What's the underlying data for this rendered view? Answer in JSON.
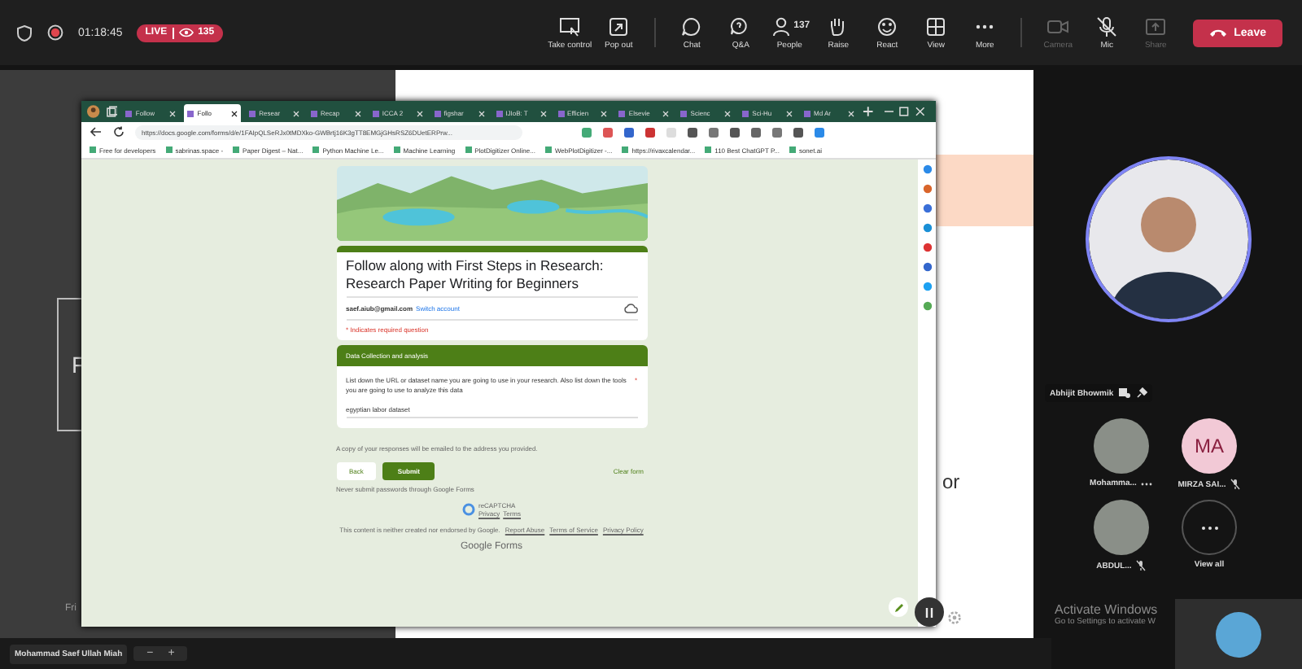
{
  "meeting_bar": {
    "time": "01:18:45",
    "live_label": "LIVE",
    "viewer_count": "135",
    "leave": "Leave",
    "tools": [
      {
        "label": "Take control",
        "kind": "control",
        "disabled": false
      },
      {
        "label": "Pop out",
        "kind": "popout",
        "disabled": false
      },
      {
        "label": "Chat",
        "kind": "chat",
        "disabled": false
      },
      {
        "label": "Q&A",
        "kind": "qa",
        "disabled": false
      },
      {
        "label": "People",
        "kind": "people",
        "count": "137",
        "disabled": false
      },
      {
        "label": "Raise",
        "kind": "hand",
        "disabled": false
      },
      {
        "label": "React",
        "kind": "smile",
        "disabled": false
      },
      {
        "label": "View",
        "kind": "grid",
        "disabled": false
      },
      {
        "label": "More",
        "kind": "dots",
        "disabled": false
      },
      {
        "label": "Camera",
        "kind": "camera",
        "disabled": true
      },
      {
        "label": "Mic",
        "kind": "mic",
        "disabled": false
      },
      {
        "label": "Share",
        "kind": "share",
        "disabled": true
      }
    ]
  },
  "browser": {
    "tabs": [
      {
        "label": "Follow",
        "selected": false
      },
      {
        "label": "Follo",
        "selected": true
      },
      {
        "label": "Resear",
        "selected": false
      },
      {
        "label": "Recap",
        "selected": false
      },
      {
        "label": "ICCA 2",
        "selected": false
      },
      {
        "label": "figshar",
        "selected": false
      },
      {
        "label": "IJIoB: T",
        "selected": false
      },
      {
        "label": "Efficien",
        "selected": false
      },
      {
        "label": "Elsevie",
        "selected": false
      },
      {
        "label": "Scienc",
        "selected": false
      },
      {
        "label": "Sci-Hu",
        "selected": false
      },
      {
        "label": "Md Ar",
        "selected": false
      }
    ],
    "url": "https://docs.google.com/forms/d/e/1FAIpQLSeRJx0tMDXko-GWBrtj16K3gTT8EMGjGHsRSZ6DUetERPrw...",
    "bookmarks": [
      "Free for developers",
      "sabrinas.space -",
      "Paper Digest – Nat...",
      "Python Machine Le...",
      "Machine Learning",
      "PlotDigitizer Online...",
      "WebPlotDigitizer -...",
      "https://rivaxcalendar...",
      "110 Best ChatGPT P...",
      "sonet.ai"
    ]
  },
  "form": {
    "title": "Follow along with First Steps in Research: Research Paper Writing for Beginners",
    "account": "saef.aiub@gmail.com",
    "switch_account": "Switch account",
    "required_note": "* Indicates required question",
    "section_title": "Data Collection and analysis",
    "question": "List down the URL or dataset name you are going to use in your research. Also list down the tools you are going to use to analyze this data",
    "required_mark": "*",
    "answer": "egyptian labor dataset",
    "copy_note": "A copy of your responses will be emailed to the address you provided.",
    "back": "Back",
    "submit": "Submit",
    "clear": "Clear form",
    "password_note": "Never submit passwords through Google Forms",
    "recaptcha": "reCAPTCHA",
    "privacy": "Privacy",
    "terms": "Terms",
    "disclaimer": "This content is neither created nor endorsed by Google.",
    "report": "Report Abuse",
    "tos": "Terms of Service",
    "privacy_policy": "Privacy Policy",
    "brand": "Google Forms"
  },
  "slides": {
    "left_letter": "F",
    "left_footer": "Fri",
    "right_text": "or"
  },
  "presenter": {
    "name": "Mohammad Saef Ullah Miah",
    "zoom_out": "−",
    "zoom_in": "+"
  },
  "participants": {
    "spotlight": {
      "name": "Abhijit Bhowmik"
    },
    "list": [
      {
        "name": "Mohamma...",
        "muted": false,
        "more": true
      },
      {
        "name": "MIRZA SAI...",
        "initials": "MA",
        "muted": true,
        "more": false
      },
      {
        "name": "ABDUL...",
        "muted": true,
        "more": false
      }
    ],
    "view_all": "View all"
  },
  "activation": {
    "title": "Activate Windows",
    "subtitle": "Go to Settings to activate W"
  }
}
